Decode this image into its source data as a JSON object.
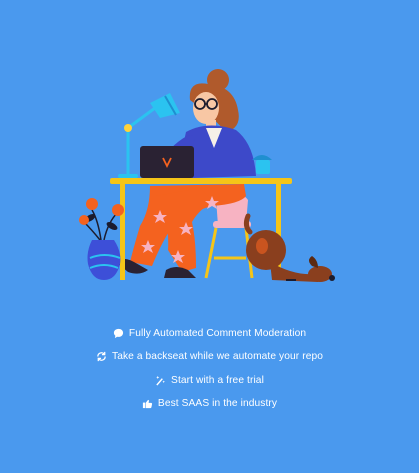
{
  "colors": {
    "background": "#4a99ee",
    "text": "#ffffff",
    "desk": "#f5c518",
    "pants": "#f4621f",
    "jacket": "#3d49c9",
    "hair": "#b05a2c",
    "dog": "#8a3f1e",
    "chair": "#f7b3c2",
    "vase": "#3d4fd8",
    "lamp": "#2bc3f0"
  },
  "illustration": {
    "icon": "woman-at-desk-with-laptop-and-dog-illustration"
  },
  "features": [
    {
      "icon": "comment-icon",
      "label": "Fully Automated Comment Moderation"
    },
    {
      "icon": "sync-icon",
      "label": "Take a backseat while we automate your repo"
    },
    {
      "icon": "magic-wand-icon",
      "label": "Start with a free trial"
    },
    {
      "icon": "thumbs-up-icon",
      "label": "Best SAAS in the industry"
    }
  ]
}
